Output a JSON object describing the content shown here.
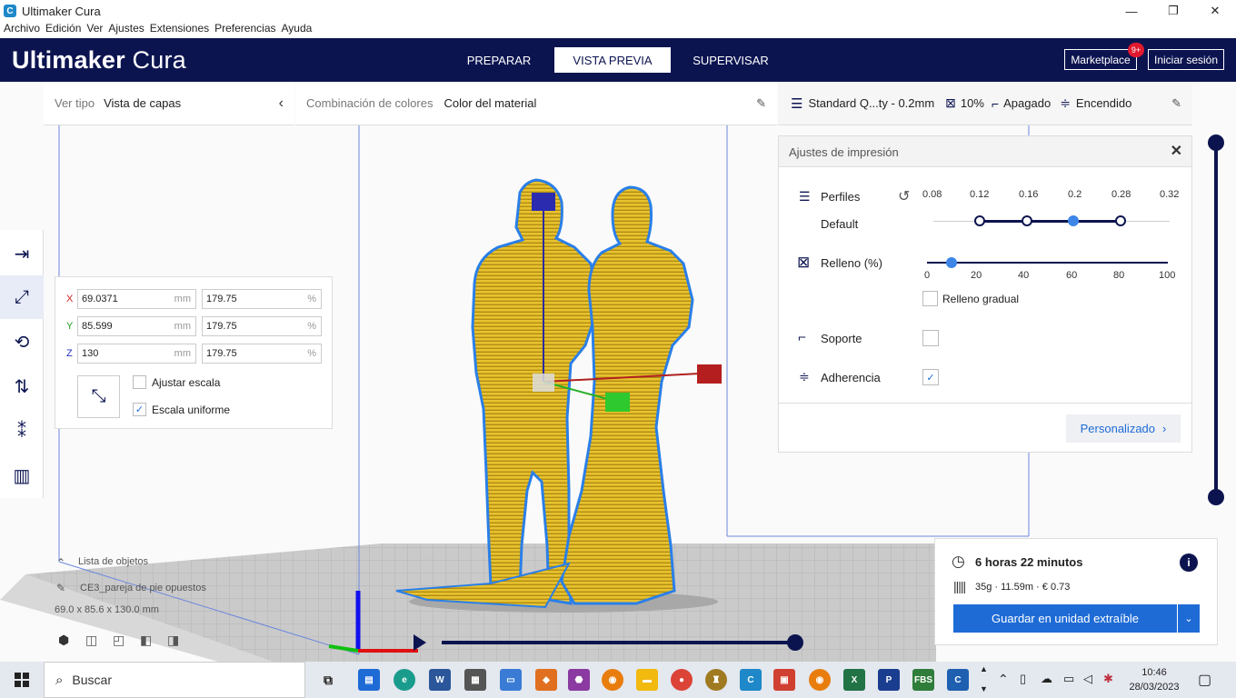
{
  "window": {
    "title": "Ultimaker Cura",
    "minimize": "—",
    "maximize": "❐",
    "close": "✕"
  },
  "menu": [
    "Archivo",
    "Edición",
    "Ver",
    "Ajustes",
    "Extensiones",
    "Preferencias",
    "Ayuda"
  ],
  "header": {
    "brand_bold": "Ultimaker",
    "brand_light": " Cura",
    "tabs": [
      "PREPARAR",
      "VISTA PREVIA",
      "SUPERVISAR"
    ],
    "active_tab": "VISTA PREVIA",
    "marketplace": "Marketplace",
    "marketplace_badge": "9+",
    "signin": "Iniciar sesión"
  },
  "viewbar": {
    "label": "Ver tipo",
    "value": "Vista de capas"
  },
  "colorbar": {
    "label": "Combinación de colores",
    "value": "Color del material"
  },
  "printbar": {
    "profile": "Standard Q...ty - 0.2mm",
    "infill": "10%",
    "support": "Apagado",
    "adhesion": "Encendido"
  },
  "scale": {
    "x": "69.0371",
    "y": "85.599",
    "z": "130",
    "x_pct": "179.75",
    "y_pct": "179.75",
    "z_pct": "179.75",
    "unit_mm": "mm",
    "unit_pct": "%",
    "snap_label": "Ajustar escala",
    "snap_checked": false,
    "uniform_label": "Escala uniforme",
    "uniform_checked": true
  },
  "print_settings": {
    "title": "Ajustes de impresión",
    "profiles_label": "Perfiles",
    "profile_name": "Default",
    "layer_heights": [
      "0.08",
      "0.12",
      "0.16",
      "0.2",
      "0.28",
      "0.32"
    ],
    "selected_layer_height": "0.2",
    "infill_label": "Relleno (%)",
    "infill_ticks": [
      "0",
      "20",
      "40",
      "60",
      "80",
      "100"
    ],
    "infill_value": 10,
    "gradual_label": "Relleno gradual",
    "gradual_checked": false,
    "support_label": "Soporte",
    "support_checked": false,
    "adhesion_label": "Adherencia",
    "adhesion_checked": true,
    "custom_button": "Personalizado"
  },
  "objects": {
    "list_label": "Lista de objetos",
    "object_name": "CE3_pareja de pie opuestos",
    "dimensions": "69.0 x 85.6 x 130.0 mm"
  },
  "output": {
    "time": "6 horas 22 minutos",
    "material": "35g · 11.59m · € 0.73",
    "save_button": "Guardar en unidad extraíble"
  },
  "layer_progress": 1.0,
  "colors": {
    "header_bg": "#0c1450",
    "accent_blue": "#1e6bd6",
    "model_yellow": "#e8c22f",
    "outline_blue": "#2a7fe8",
    "build_plate": "#c8c8c8"
  },
  "taskbar": {
    "search_placeholder": "Buscar",
    "time": "10:46",
    "date": "28/03/2023",
    "apps": [
      "task-view",
      "store",
      "edge",
      "word",
      "calculator",
      "explorer",
      "app-orange",
      "app-purple",
      "blender",
      "files",
      "chrome",
      "app-gold",
      "cura",
      "app-red",
      "blender",
      "excel",
      "app-p",
      "fbs",
      "cura"
    ]
  }
}
